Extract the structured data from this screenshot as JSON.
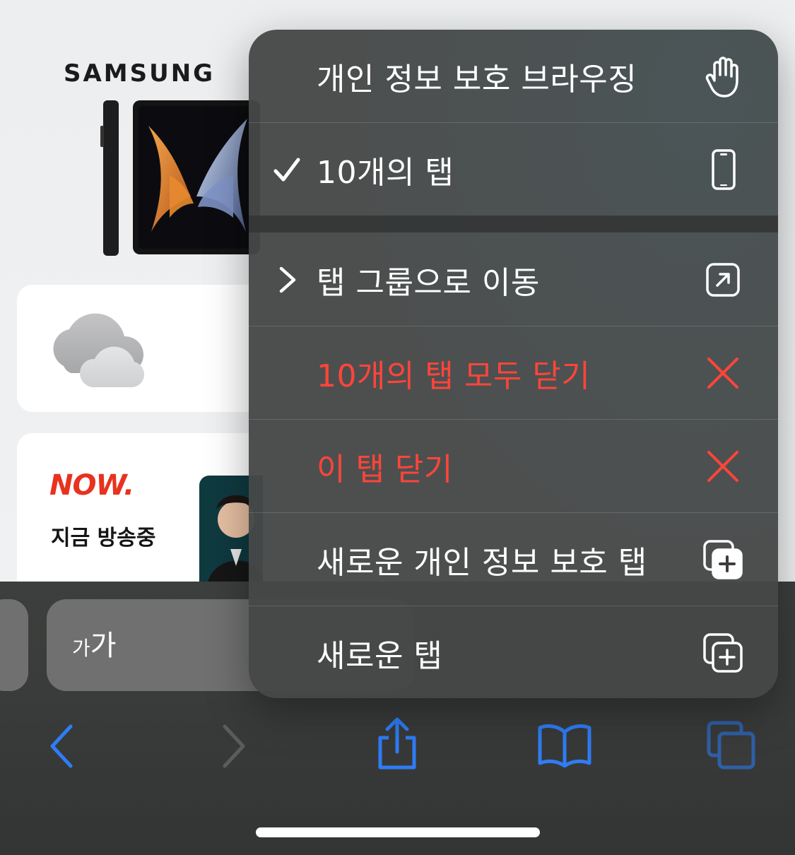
{
  "background": {
    "brand_logo": "SAMSUNG",
    "now_logo": "NOW.",
    "now_subtitle": "지금 방송중"
  },
  "toolbar": {
    "text_size_small": "가",
    "text_size_large": "가",
    "icons": [
      "back-chevron-icon",
      "forward-chevron-icon",
      "share-icon",
      "bookmarks-book-icon",
      "tabs-overview-icon"
    ],
    "accent_color": "#2f7cf6"
  },
  "menu": {
    "items": [
      {
        "label": "개인 정보 보호 브라우징",
        "icon": "hand-raised-icon",
        "color": "#ffffff"
      },
      {
        "label": "10개의 탭",
        "icon": "iphone-icon",
        "checked": true,
        "color": "#ffffff"
      },
      {
        "label": "탭 그룹으로 이동",
        "icon": "arrow-up-right-square-icon",
        "chevron": true,
        "color": "#ffffff"
      },
      {
        "label": "10개의 탭 모두 닫기",
        "icon": "xmark-icon",
        "color": "#ff453a"
      },
      {
        "label": "이 탭 닫기",
        "icon": "xmark-icon",
        "color": "#ff453a"
      },
      {
        "label": "새로운 개인 정보 보호 탭",
        "icon": "plus-square-on-square-filled-icon",
        "color": "#ffffff"
      },
      {
        "label": "새로운 탭",
        "icon": "plus-square-on-square-icon",
        "color": "#ffffff"
      }
    ]
  }
}
